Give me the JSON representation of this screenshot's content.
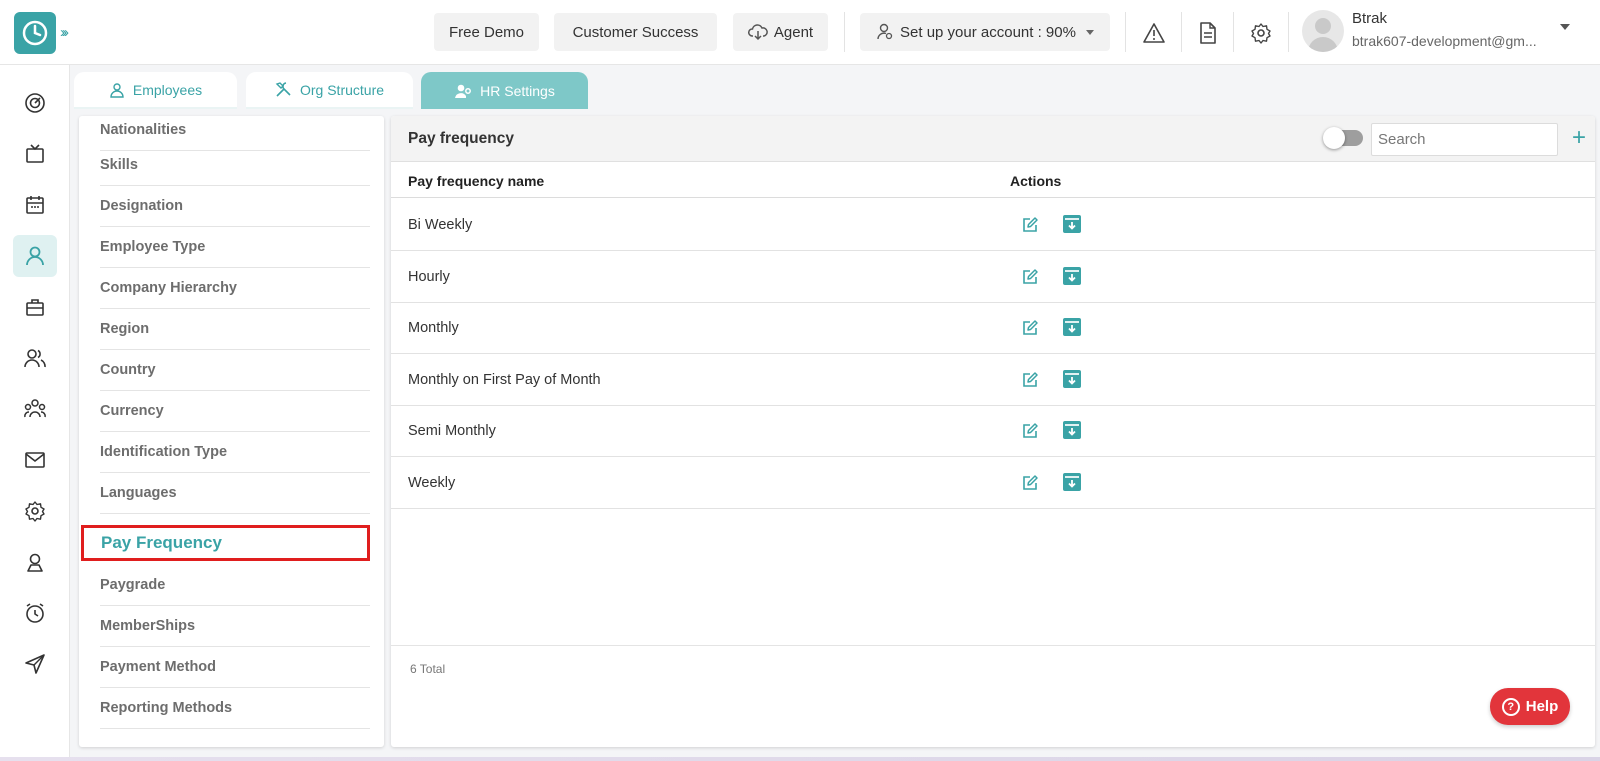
{
  "topbar": {
    "free_demo": "Free Demo",
    "customer_success": "Customer Success",
    "agent": "Agent",
    "setup": "Set up your account : 90%",
    "user_name": "Btrak",
    "user_email": "btrak607-development@gm..."
  },
  "tabs": [
    {
      "label": "Employees",
      "icon": "person-icon"
    },
    {
      "label": "Org Structure",
      "icon": "tools-icon"
    },
    {
      "label": "HR Settings",
      "icon": "user-gear-icon"
    }
  ],
  "menu": {
    "items": [
      "Nationalities",
      "Skills",
      "Designation",
      "Employee Type",
      "Company Hierarchy",
      "Region",
      "Country",
      "Currency",
      "Identification Type",
      "Languages",
      "Pay Frequency",
      "Paygrade",
      "MemberShips",
      "Payment Method",
      "Reporting Methods"
    ],
    "selected": "Pay Frequency"
  },
  "content": {
    "title": "Pay frequency",
    "search_placeholder": "Search",
    "columns": [
      "Pay frequency name",
      "Actions"
    ],
    "rows": [
      "Bi Weekly",
      "Hourly",
      "Monthly",
      "Monthly on First Pay of Month",
      "Semi Monthly",
      "Weekly"
    ],
    "total": "6 Total"
  },
  "help": {
    "label": "Help"
  },
  "colors": {
    "accent": "#3aa3a6",
    "highlight": "#e01e1e",
    "help": "#e2353b",
    "tab_active": "#7ec8c8"
  }
}
